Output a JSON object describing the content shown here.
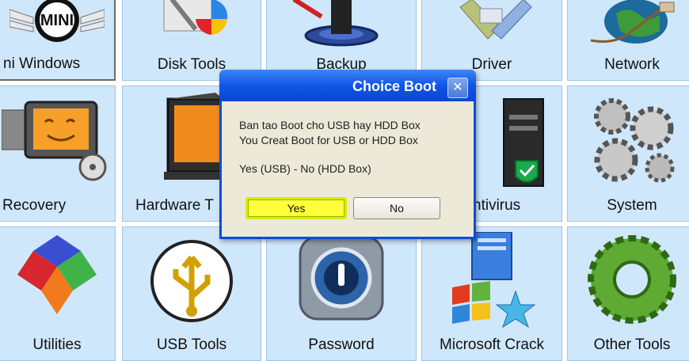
{
  "tiles": [
    {
      "label": "ni Windows",
      "icon": "mini-logo-icon"
    },
    {
      "label": "Disk Tools",
      "icon": "disk-tools-icon"
    },
    {
      "label": "Backup",
      "icon": "backup-icon"
    },
    {
      "label": "Driver",
      "icon": "driver-icon"
    },
    {
      "label": "Network",
      "icon": "network-icon"
    },
    {
      "label": "Recovery",
      "icon": "recovery-icon"
    },
    {
      "label": "Hardware T",
      "icon": "hardware-monitor-icon"
    },
    {
      "label": "ntivirus",
      "icon": "antivirus-icon"
    },
    {
      "label": "System",
      "icon": "system-gears-icon"
    },
    {
      "label": "Utilities",
      "icon": "utilities-icon"
    },
    {
      "label": "USB Tools",
      "icon": "usb-icon"
    },
    {
      "label": "Password",
      "icon": "password-lock-icon"
    },
    {
      "label": "Microsoft Crack",
      "icon": "microsoft-crack-icon"
    },
    {
      "label": "Other Tools",
      "icon": "other-tools-icon"
    }
  ],
  "dialog": {
    "title": "Choice Boot",
    "close_icon": "close-icon",
    "line1": "Ban tao Boot cho USB hay HDD Box",
    "line2": "You Creat Boot for USB or HDD Box",
    "line3": "Yes (USB) - No (HDD Box)",
    "yes_label": "Yes",
    "no_label": "No"
  },
  "colors": {
    "tile_bg": "#cfe7fb",
    "dialog_title": "#0a4fd2",
    "highlight": "#ffff3c"
  }
}
